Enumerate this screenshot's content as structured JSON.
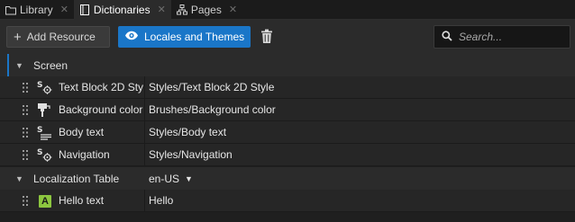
{
  "tabs": [
    {
      "label": "Library",
      "icon": "folder-icon",
      "active": false
    },
    {
      "label": "Dictionaries",
      "icon": "book-icon",
      "active": true
    },
    {
      "label": "Pages",
      "icon": "tree-icon",
      "active": false
    }
  ],
  "toolbar": {
    "add_label": "Add Resource",
    "locales_label": "Locales and Themes",
    "search_placeholder": "Search...",
    "accent_color": "#1a76c8"
  },
  "groups": {
    "screen": {
      "label": "Screen",
      "rows": [
        {
          "name": "Text Block 2D Style",
          "value": "Styles/Text Block 2D Style",
          "icon": "style-icon"
        },
        {
          "name": "Background color",
          "value": "Brushes/Background color",
          "icon": "brush-icon"
        },
        {
          "name": "Body text",
          "value": "Styles/Body text",
          "icon": "style-icon"
        },
        {
          "name": "Navigation",
          "value": "Styles/Navigation",
          "icon": "style-icon"
        }
      ]
    },
    "localization": {
      "label": "Localization Table",
      "locale": "en-US",
      "rows": [
        {
          "name": "Hello text",
          "value": "Hello",
          "icon": "text-icon",
          "badge": "A"
        }
      ]
    }
  }
}
